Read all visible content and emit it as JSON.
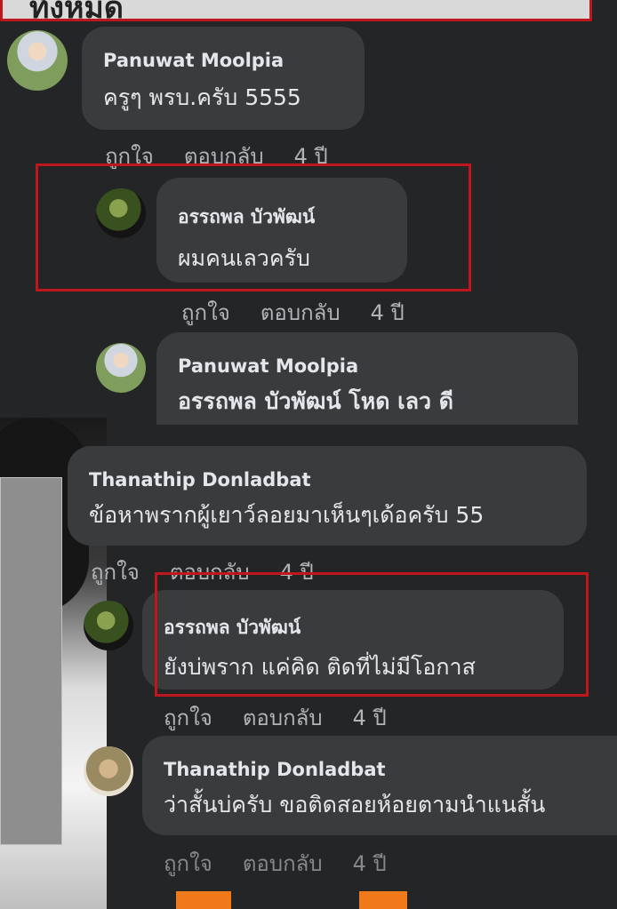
{
  "top_banner": {
    "text": "ทั้งหมด"
  },
  "comments": [
    {
      "name": "Panuwat Moolpia",
      "text": "ครูๆ พรบ.ครับ 5555",
      "actions": {
        "like": "ถูกใจ",
        "reply": "ตอบกลับ",
        "time": "4 ปี"
      }
    },
    {
      "name": "อรรถพล บัวพัฒน์",
      "text": "ผมคนเลวครับ",
      "actions": {
        "like": "ถูกใจ",
        "reply": "ตอบกลับ",
        "time": "4 ปี"
      }
    },
    {
      "name": "Panuwat Moolpia",
      "mention": "อรรถพล บัวพัฒน์",
      "text": "โหด เลว ดี"
    },
    {
      "name": "Thanathip Donladbat",
      "text": "ข้อหาพรากผู้เยาว์ลอยมาเห็นๆเด้อครับ 55",
      "actions": {
        "like": "ถูกใจ",
        "reply": "ตอบกลับ",
        "time": "4 ปี"
      }
    },
    {
      "name": "อรรถพล บัวพัฒน์",
      "text": "ยังบ่พราก แค่คิด ติดที่ไม่มีโอกาส",
      "actions": {
        "like": "ถูกใจ",
        "reply": "ตอบกลับ",
        "time": "4 ปี"
      }
    },
    {
      "name": "Thanathip Donladbat",
      "text": "ว่าสั้นบ่ครับ ขอติดสอยห้อยตามนำแนสั้น",
      "actions": {
        "like": "ถูกใจ",
        "reply": "ตอบกลับ",
        "time": "4 ปี"
      }
    }
  ],
  "colors": {
    "background": "#242526",
    "bubble": "#3a3b3c",
    "highlight": "#c0161d",
    "action_text": "#b0b3b8",
    "accent": "#f07a1a"
  }
}
